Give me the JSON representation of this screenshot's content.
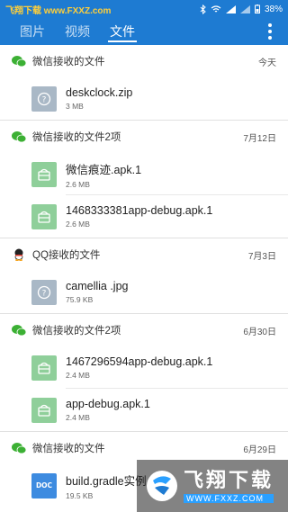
{
  "status_bar": {
    "watermark_text": "飞翔下载 www.FXXZ.com",
    "battery": "38%"
  },
  "tabs": [
    {
      "label": "图片",
      "active": false
    },
    {
      "label": "视频",
      "active": false
    },
    {
      "label": "文件",
      "active": true
    }
  ],
  "groups": [
    {
      "source": "wechat",
      "title": "微信接收的文件",
      "date": "今天",
      "files": [
        {
          "name": "deskclock.zip",
          "size": "3 MB",
          "type": "unknown"
        }
      ]
    },
    {
      "source": "wechat",
      "title": "微信接收的文件2项",
      "date": "7月12日",
      "files": [
        {
          "name": "微信痕迹.apk.1",
          "size": "2.6 MB",
          "type": "apk"
        },
        {
          "name": "1468333381app-debug.apk.1",
          "size": "2.6 MB",
          "type": "apk"
        }
      ]
    },
    {
      "source": "qq",
      "title": "QQ接收的文件",
      "date": "7月3日",
      "files": [
        {
          "name": "camellia .jpg",
          "size": "75.9 KB",
          "type": "unknown"
        }
      ]
    },
    {
      "source": "wechat",
      "title": "微信接收的文件2项",
      "date": "6月30日",
      "files": [
        {
          "name": "1467296594app-debug.apk.1",
          "size": "2.4 MB",
          "type": "apk"
        },
        {
          "name": "app-debug.apk.1",
          "size": "2.4 MB",
          "type": "apk"
        }
      ]
    },
    {
      "source": "wechat",
      "title": "微信接收的文件",
      "date": "6月29日",
      "files": [
        {
          "name": "build.gradle实例.do",
          "size": "19.5 KB",
          "type": "doc"
        }
      ]
    }
  ],
  "watermark": {
    "big": "飞翔下载",
    "small": "WWW.FXXZ.COM"
  },
  "doc_label": "DOC",
  "colors": {
    "primary": "#1e7bd2",
    "wechat": "#3cb034",
    "apk": "#8fcf9a",
    "unknown": "#a9b8c6",
    "doc": "#3d8be0"
  }
}
